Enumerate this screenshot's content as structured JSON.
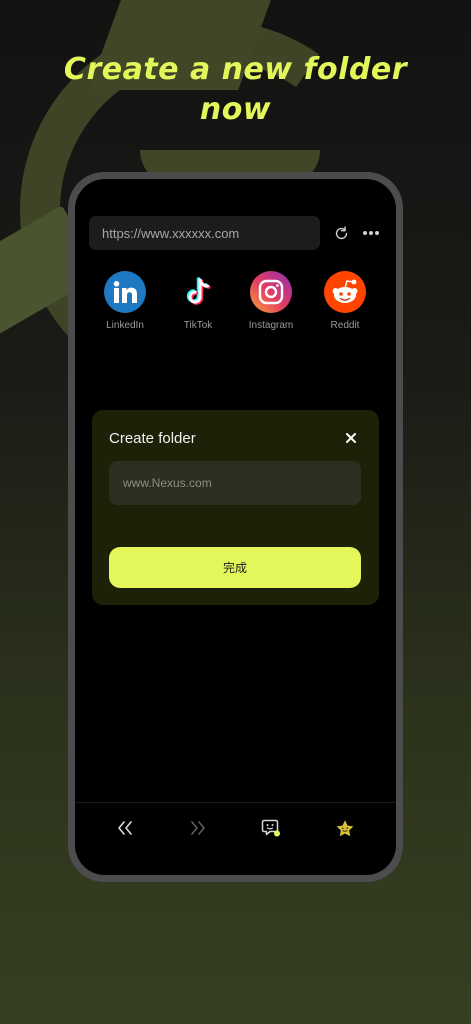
{
  "headline": {
    "line1": "Create a new folder",
    "line2": "now"
  },
  "browser": {
    "url": "https://www.xxxxxx.com",
    "refresh_icon": "refresh-icon",
    "more_icon": "more-dots-icon"
  },
  "shortcuts": [
    {
      "label": "LinkedIn",
      "icon": "linkedin-icon",
      "color": "#1e78c2"
    },
    {
      "label": "TikTok",
      "icon": "tiktok-icon",
      "color": "#000000"
    },
    {
      "label": "Instagram",
      "icon": "instagram-icon",
      "color": "#d62976"
    },
    {
      "label": "Reddit",
      "icon": "reddit-icon",
      "color": "#ff4500"
    }
  ],
  "dialog": {
    "title": "Create folder",
    "input_placeholder": "www.Nexus.com",
    "done_label": "完成"
  },
  "bottom_nav": [
    {
      "icon": "back-icon"
    },
    {
      "icon": "forward-icon"
    },
    {
      "icon": "assistant-icon"
    },
    {
      "icon": "favorites-star-icon"
    }
  ],
  "colors": {
    "accent": "#e3f75a",
    "dialog_bg": "#1c2108",
    "screen_bg": "#000000"
  }
}
